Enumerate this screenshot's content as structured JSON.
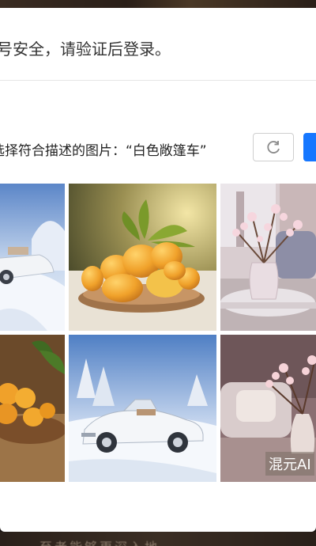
{
  "dialog": {
    "header_text": "账号安全，请验证后登录。"
  },
  "captcha": {
    "instruction": "请选择符合描述的图片：“白色敞篷车”",
    "tiles": [
      {
        "subject": "white-convertible-snow"
      },
      {
        "subject": "loquats-plate"
      },
      {
        "subject": "cherry-blossom-vase"
      },
      {
        "subject": "loquats-plate-cropped"
      },
      {
        "subject": "white-convertible-snow"
      },
      {
        "subject": "cherry-blossom-room"
      }
    ],
    "watermark": "混元AI"
  },
  "background": {
    "bottom_text": "至者能够更深入地"
  },
  "colors": {
    "primary": "#1677ff",
    "border": "#e6e6e6"
  },
  "icons": {
    "refresh": "refresh-icon"
  }
}
